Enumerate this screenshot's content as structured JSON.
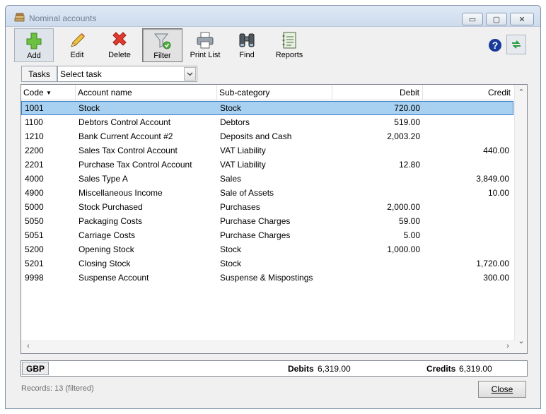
{
  "window": {
    "title": "Nominal accounts",
    "minimize_glyph": "▭",
    "maximize_glyph": "▢",
    "close_glyph": "✕"
  },
  "toolbar": {
    "add": "Add",
    "edit": "Edit",
    "delete": "Delete",
    "filter": "Filter",
    "print_list": "Print List",
    "find": "Find",
    "reports": "Reports"
  },
  "tasks": {
    "button": "Tasks",
    "selected": "Select task"
  },
  "grid": {
    "columns": {
      "code": "Code",
      "name": "Account name",
      "subcategory": "Sub-category",
      "debit": "Debit",
      "credit": "Credit"
    },
    "sort_indicator": "▼",
    "rows": [
      {
        "code": "1001",
        "name": "Stock",
        "subcategory": "Stock",
        "debit": "720.00",
        "credit": ""
      },
      {
        "code": "1100",
        "name": "Debtors Control Account",
        "subcategory": "Debtors",
        "debit": "519.00",
        "credit": ""
      },
      {
        "code": "1210",
        "name": "Bank Current Account #2",
        "subcategory": "Deposits and Cash",
        "debit": "2,003.20",
        "credit": ""
      },
      {
        "code": "2200",
        "name": "Sales Tax Control Account",
        "subcategory": "VAT Liability",
        "debit": "",
        "credit": "440.00"
      },
      {
        "code": "2201",
        "name": "Purchase Tax Control Account",
        "subcategory": "VAT Liability",
        "debit": "12.80",
        "credit": ""
      },
      {
        "code": "4000",
        "name": "Sales Type A",
        "subcategory": "Sales",
        "debit": "",
        "credit": "3,849.00"
      },
      {
        "code": "4900",
        "name": "Miscellaneous Income",
        "subcategory": "Sale of Assets",
        "debit": "",
        "credit": "10.00"
      },
      {
        "code": "5000",
        "name": "Stock Purchased",
        "subcategory": "Purchases",
        "debit": "2,000.00",
        "credit": ""
      },
      {
        "code": "5050",
        "name": "Packaging Costs",
        "subcategory": "Purchase Charges",
        "debit": "59.00",
        "credit": ""
      },
      {
        "code": "5051",
        "name": "Carriage Costs",
        "subcategory": "Purchase Charges",
        "debit": "5.00",
        "credit": ""
      },
      {
        "code": "5200",
        "name": "Opening Stock",
        "subcategory": "Stock",
        "debit": "1,000.00",
        "credit": ""
      },
      {
        "code": "5201",
        "name": "Closing Stock",
        "subcategory": "Stock",
        "debit": "",
        "credit": "1,720.00"
      },
      {
        "code": "9998",
        "name": "Suspense Account",
        "subcategory": "Suspense & Mispostings",
        "debit": "",
        "credit": "300.00"
      }
    ]
  },
  "totals": {
    "currency": "GBP",
    "debits_label": "Debits",
    "debits_value": "6,319.00",
    "credits_label": "Credits",
    "credits_value": "6,319.00"
  },
  "status": {
    "records": "Records: 13 (filtered)"
  },
  "close_button": "Close",
  "colors": {
    "selection": "#a8d0f0",
    "selection_border": "#3b7fc7"
  }
}
